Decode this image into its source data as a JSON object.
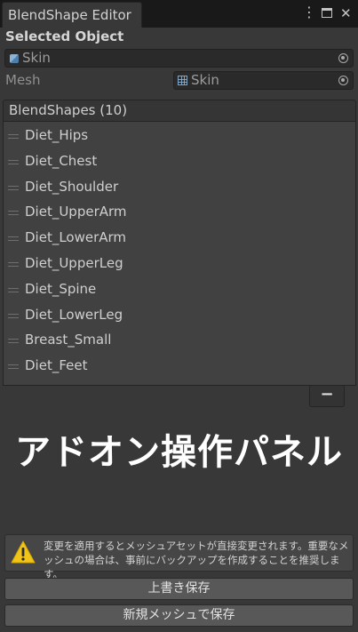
{
  "window": {
    "tab_title": "BlendShape Editor"
  },
  "selected": {
    "heading": "Selected Object",
    "object_value": "Skin",
    "mesh_label": "Mesh",
    "mesh_value": "Skin"
  },
  "blendshapes": {
    "header": "BlendShapes (10)",
    "items": [
      "Diet_Hips",
      "Diet_Chest",
      "Diet_Shoulder",
      "Diet_UpperArm",
      "Diet_LowerArm",
      "Diet_UpperLeg",
      "Diet_Spine",
      "Diet_LowerLeg",
      "Breast_Small",
      "Diet_Feet"
    ],
    "remove_label": "−"
  },
  "addon": {
    "title": "アドオン操作パネル"
  },
  "warning": {
    "text": "変更を適用するとメッシュアセットが直接変更されます。重要なメッシュの場合は、事前にバックアップを作成することを推奨します。"
  },
  "buttons": {
    "overwrite": "上書き保存",
    "save_new": "新規メッシュで保存"
  },
  "colors": {
    "background": "#383838",
    "warning_icon": "#f0c419"
  }
}
